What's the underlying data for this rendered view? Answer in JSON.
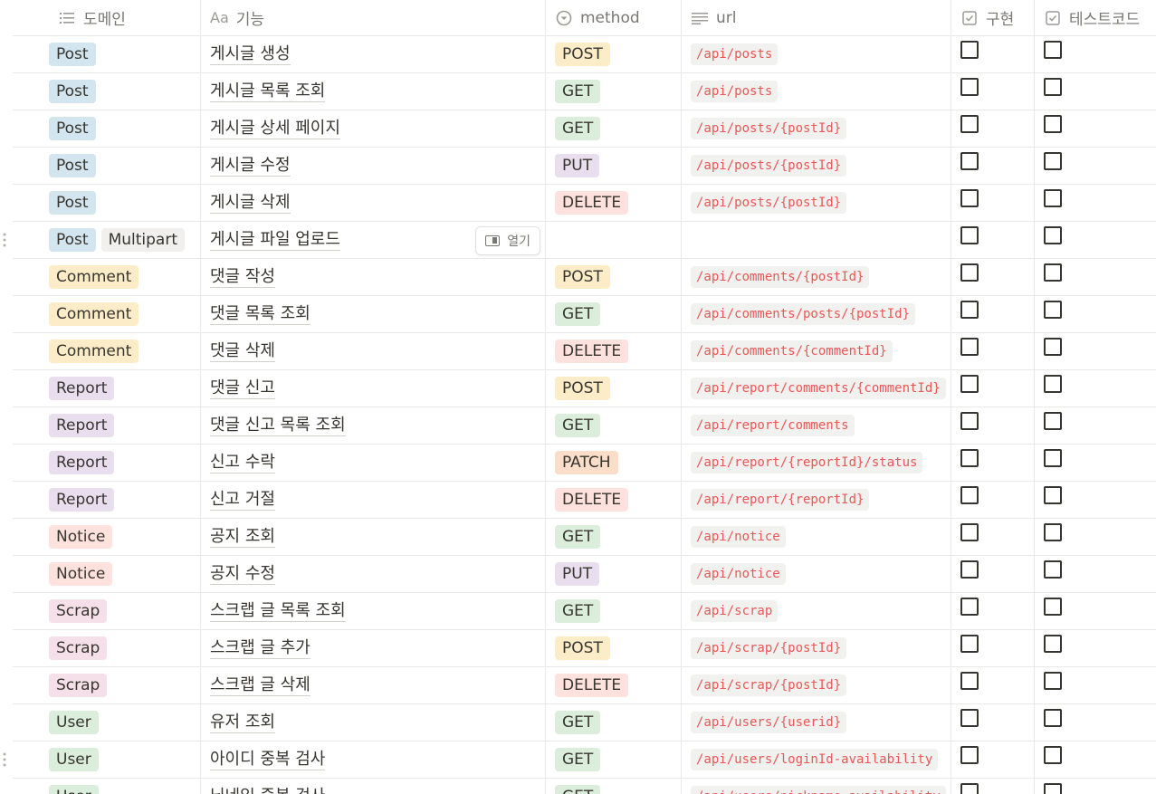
{
  "header": {
    "domain": "도메인",
    "func": "기능",
    "func_prefix": "Aa",
    "method": "method",
    "url": "url",
    "impl": "구현",
    "test": "테스트코드"
  },
  "open_button_label": "열기",
  "domain_colors": {
    "Post": "#d3e5ef",
    "Multipart": "#f1f0ef",
    "Comment": "#fdecc8",
    "Report": "#e8deee",
    "Notice": "#ffe2dd",
    "Scrap": "#f5e0e9",
    "User": "#dbeddb"
  },
  "method_colors": {
    "POST": "#fdecc8",
    "GET": "#dbeddb",
    "PUT": "#e8deee",
    "DELETE": "#ffe2dd",
    "PATCH": "#fadec9"
  },
  "rows": [
    {
      "domains": [
        "Post"
      ],
      "func": "게시글 생성",
      "method": "POST",
      "url": "/api/posts",
      "impl": false,
      "test": false
    },
    {
      "domains": [
        "Post"
      ],
      "func": "게시글 목록 조회",
      "method": "GET",
      "url": "/api/posts",
      "impl": false,
      "test": false
    },
    {
      "domains": [
        "Post"
      ],
      "func": "게시글 상세 페이지",
      "method": "GET",
      "url": "/api/posts/{postId}",
      "impl": false,
      "test": false
    },
    {
      "domains": [
        "Post"
      ],
      "func": "게시글 수정",
      "method": "PUT",
      "url": "/api/posts/{postId}",
      "impl": false,
      "test": false
    },
    {
      "domains": [
        "Post"
      ],
      "func": "게시글 삭제",
      "method": "DELETE",
      "url": "/api/posts/{postId}",
      "impl": false,
      "test": false
    },
    {
      "domains": [
        "Post",
        "Multipart"
      ],
      "func": "게시글 파일 업로드",
      "method": "",
      "url": "",
      "impl": false,
      "test": false,
      "hover": true
    },
    {
      "domains": [
        "Comment"
      ],
      "func": "댓글 작성",
      "method": "POST",
      "url": "/api/comments/{postId}",
      "impl": false,
      "test": false
    },
    {
      "domains": [
        "Comment"
      ],
      "func": "댓글 목록 조회",
      "method": "GET",
      "url": "/api/comments/posts/{postId}",
      "impl": false,
      "test": false
    },
    {
      "domains": [
        "Comment"
      ],
      "func": "댓글 삭제",
      "method": "DELETE",
      "url": "/api/comments/{commentId}",
      "impl": false,
      "test": false
    },
    {
      "domains": [
        "Report"
      ],
      "func": "댓글 신고",
      "method": "POST",
      "url": "/api/report/comments/{commentId}",
      "impl": false,
      "test": false
    },
    {
      "domains": [
        "Report"
      ],
      "func": "댓글 신고 목록 조회",
      "method": "GET",
      "url": "/api/report/comments",
      "impl": false,
      "test": false
    },
    {
      "domains": [
        "Report"
      ],
      "func": "신고 수락",
      "method": "PATCH",
      "url": "/api/report/{reportId}/status",
      "impl": false,
      "test": false
    },
    {
      "domains": [
        "Report"
      ],
      "func": "신고 거절",
      "method": "DELETE",
      "url": "/api/report/{reportId}",
      "impl": false,
      "test": false
    },
    {
      "domains": [
        "Notice"
      ],
      "func": "공지 조회",
      "method": "GET",
      "url": "/api/notice",
      "impl": false,
      "test": false
    },
    {
      "domains": [
        "Notice"
      ],
      "func": "공지 수정",
      "method": "PUT",
      "url": "/api/notice",
      "impl": false,
      "test": false
    },
    {
      "domains": [
        "Scrap"
      ],
      "func": "스크랩 글 목록 조회",
      "method": "GET",
      "url": "/api/scrap",
      "impl": false,
      "test": false
    },
    {
      "domains": [
        "Scrap"
      ],
      "func": "스크랩 글 추가",
      "method": "POST",
      "url": "/api/scrap/{postId}",
      "impl": false,
      "test": false
    },
    {
      "domains": [
        "Scrap"
      ],
      "func": "스크랩 글 삭제",
      "method": "DELETE",
      "url": "/api/scrap/{postId}",
      "impl": false,
      "test": false
    },
    {
      "domains": [
        "User"
      ],
      "func": "유저 조회",
      "method": "GET",
      "url": "/api/users/{userid}",
      "impl": false,
      "test": false
    },
    {
      "domains": [
        "User"
      ],
      "func": "아이디 중복 검사",
      "method": "GET",
      "url": "/api/users/loginId-availability",
      "impl": false,
      "test": false,
      "drag": true
    },
    {
      "domains": [
        "User"
      ],
      "func": "닉네임 중복 검사",
      "method": "GET",
      "url": "/api/users/nickname-availability",
      "impl": false,
      "test": false
    }
  ]
}
